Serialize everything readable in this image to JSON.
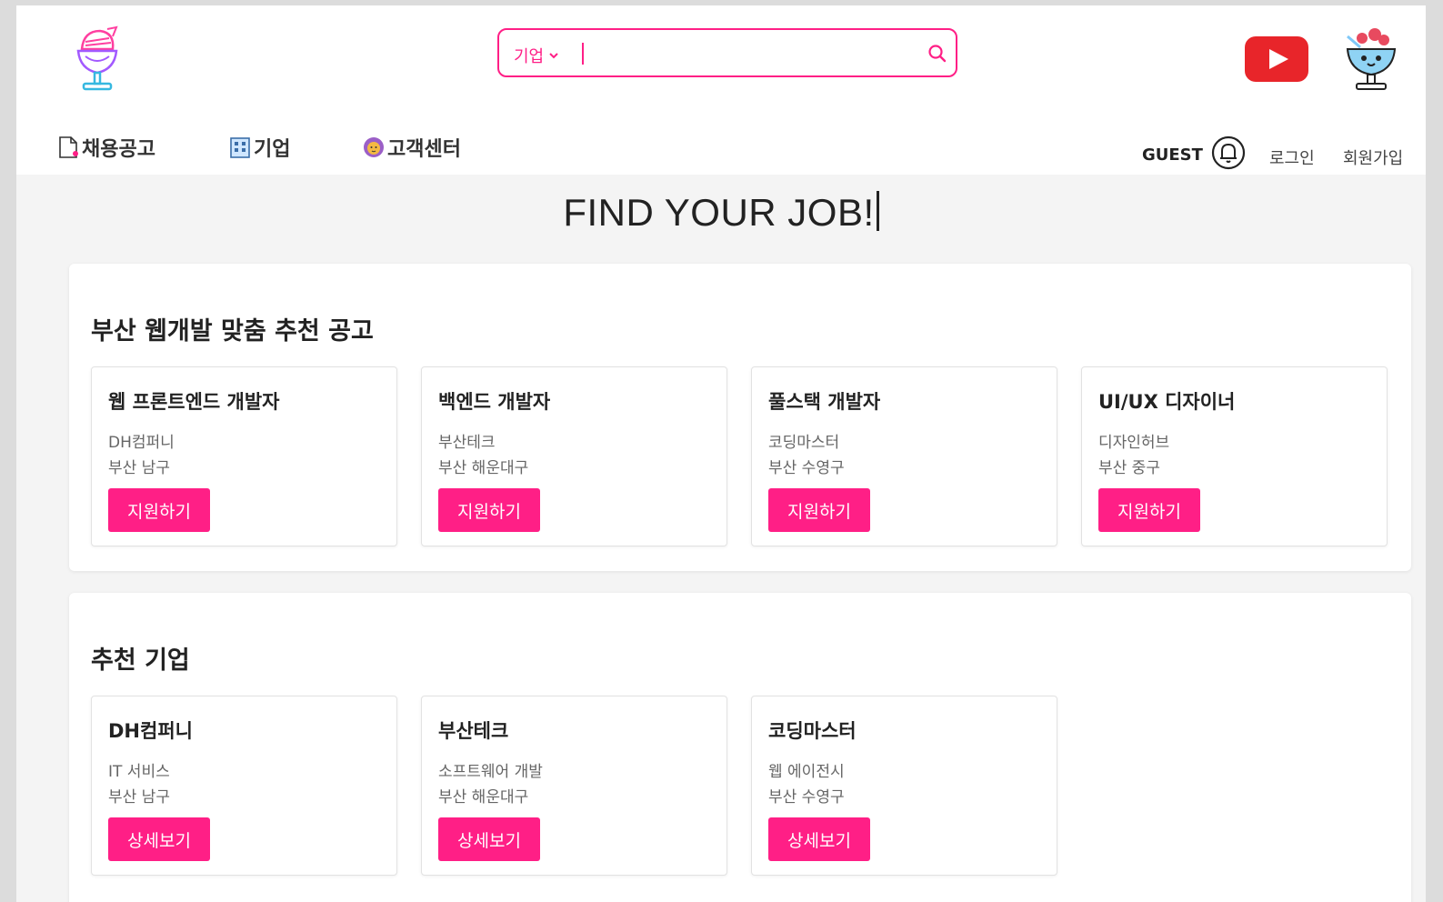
{
  "header": {
    "search": {
      "category": "기업",
      "placeholder": ""
    },
    "nav": [
      {
        "label": "채용공고",
        "icon": "document-icon"
      },
      {
        "label": "기업",
        "icon": "building-icon"
      },
      {
        "label": "고객센터",
        "icon": "lion-icon"
      }
    ],
    "user": {
      "guest": "GUEST",
      "login": "로그인",
      "signup": "회원가입"
    }
  },
  "hero": {
    "title": "FIND YOUR JOB!"
  },
  "jobs": {
    "title": "부산 웹개발 맞춤 추천 공고",
    "items": [
      {
        "title": "웹 프론트엔드 개발자",
        "company": "DH컴퍼니",
        "location": "부산 남구",
        "button": "지원하기"
      },
      {
        "title": "백엔드 개발자",
        "company": "부산테크",
        "location": "부산 해운대구",
        "button": "지원하기"
      },
      {
        "title": "풀스택 개발자",
        "company": "코딩마스터",
        "location": "부산 수영구",
        "button": "지원하기"
      },
      {
        "title": "UI/UX 디자이너",
        "company": "디자인허브",
        "location": "부산 중구",
        "button": "지원하기"
      }
    ]
  },
  "companies": {
    "title": "추천 기업",
    "items": [
      {
        "name": "DH컴퍼니",
        "industry": "IT 서비스",
        "location": "부산 남구",
        "button": "상세보기"
      },
      {
        "name": "부산테크",
        "industry": "소프트웨어 개발",
        "location": "부산 해운대구",
        "button": "상세보기"
      },
      {
        "name": "코딩마스터",
        "industry": "웹 에이전시",
        "location": "부산 수영구",
        "button": "상세보기"
      }
    ]
  },
  "colors": {
    "accent": "#ff1f86",
    "youtube": "#e8252a",
    "background": "#f4f4f4"
  }
}
